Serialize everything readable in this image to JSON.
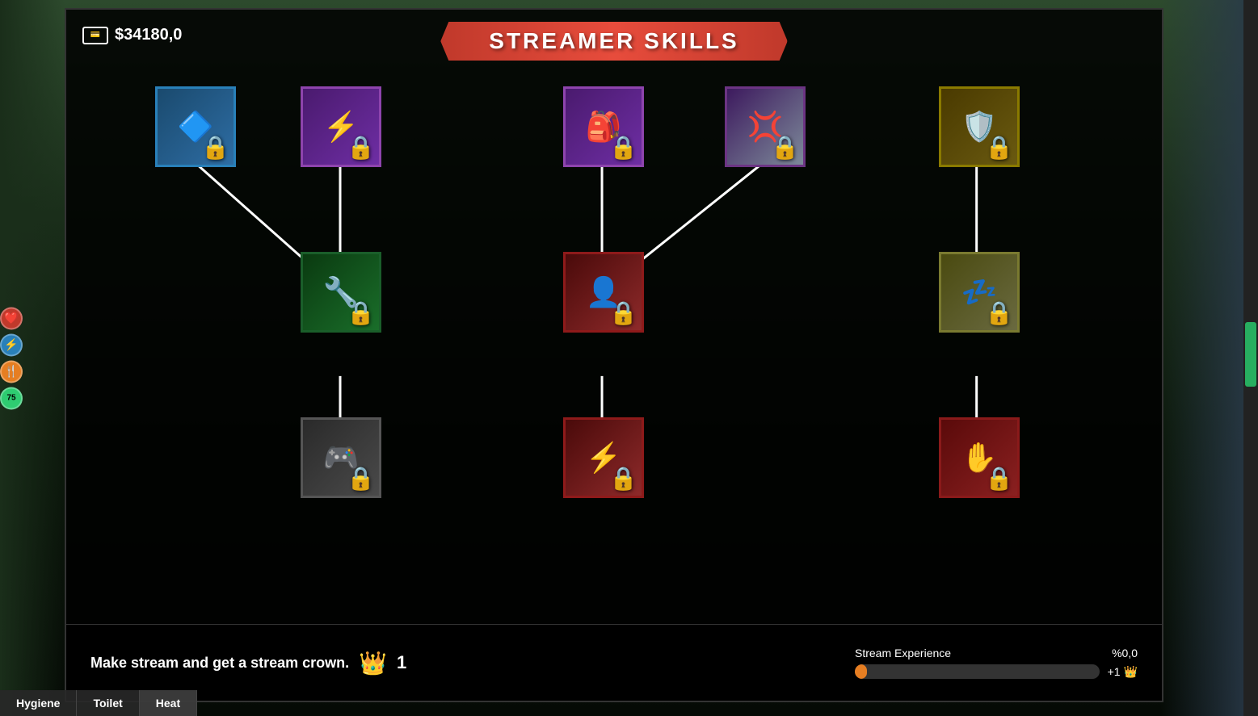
{
  "header": {
    "title": "STREAMER SKILLS"
  },
  "money": {
    "amount": "$34180,0",
    "icon": "💳"
  },
  "bottom": {
    "hint": "Make stream and get a stream crown.",
    "crown_count": "1",
    "xp_label": "Stream Experience",
    "xp_percent": "%0,0",
    "xp_reward": "+1"
  },
  "tabs": [
    {
      "label": "Hygiene",
      "active": false
    },
    {
      "label": "Toilet",
      "active": false
    },
    {
      "label": "Heat",
      "active": true
    }
  ],
  "skills": [
    {
      "id": "skill-1",
      "col": 1,
      "row": 1,
      "border_color": "blue",
      "icon": "🔷",
      "emoji_bg": "🔷",
      "locked": true
    },
    {
      "id": "skill-2",
      "col": 2,
      "row": 1,
      "border_color": "purple",
      "icon": "⚡",
      "emoji_bg": "⚡",
      "locked": true
    },
    {
      "id": "skill-3",
      "col": 3,
      "row": 1,
      "border_color": "purple",
      "icon": "🎒",
      "emoji_bg": "🎒",
      "locked": true
    },
    {
      "id": "skill-4",
      "col": 4,
      "row": 1,
      "border_color": "purple",
      "icon": "💢",
      "emoji_bg": "💢",
      "locked": true
    },
    {
      "id": "skill-5",
      "col": 5,
      "row": 1,
      "border_color": "olive",
      "icon": "🛡️",
      "emoji_bg": "🛡️",
      "locked": true
    },
    {
      "id": "skill-6",
      "col": 2,
      "row": 2,
      "border_color": "green",
      "icon": "🔧",
      "emoji_bg": "🔧",
      "locked": true
    },
    {
      "id": "skill-7",
      "col": 3,
      "row": 2,
      "border_color": "darkred",
      "icon": "👤",
      "emoji_bg": "👤",
      "locked": true
    },
    {
      "id": "skill-8",
      "col": 5,
      "row": 2,
      "border_color": "olive-dark",
      "icon": "💤",
      "emoji_bg": "💤",
      "locked": true
    },
    {
      "id": "skill-9",
      "col": 2,
      "row": 3,
      "border_color": "gray",
      "icon": "🎮",
      "emoji_bg": "🎮",
      "locked": true
    },
    {
      "id": "skill-10",
      "col": 3,
      "row": 3,
      "border_color": "darkred",
      "icon": "⚡",
      "emoji_bg": "⚡",
      "locked": true
    },
    {
      "id": "skill-11",
      "col": 5,
      "row": 3,
      "border_color": "crimson",
      "icon": "✋",
      "emoji_bg": "✋",
      "locked": true
    }
  ],
  "sidebar_icons": [
    {
      "id": "health",
      "icon": "❤️",
      "class": "health"
    },
    {
      "id": "energy",
      "icon": "⚡",
      "class": "energy"
    },
    {
      "id": "food",
      "icon": "🍴",
      "class": "food"
    },
    {
      "id": "timer",
      "icon": "75",
      "class": "timer"
    }
  ]
}
